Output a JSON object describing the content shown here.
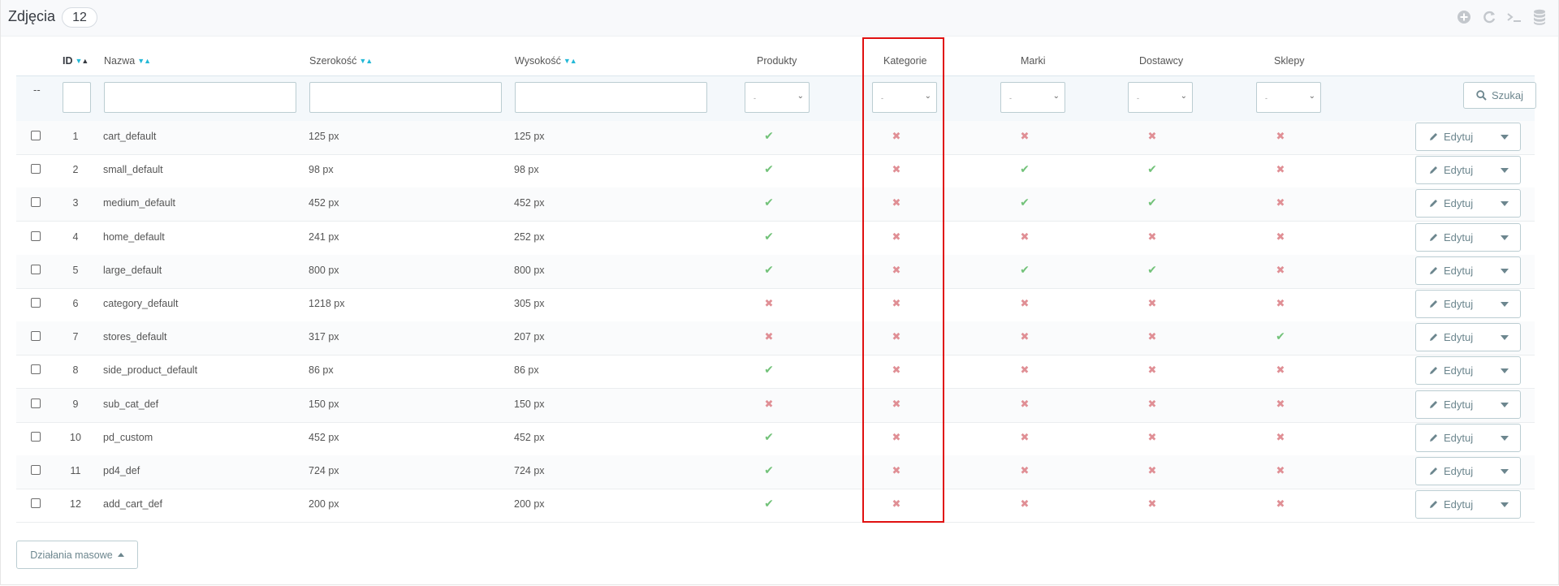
{
  "header": {
    "title": "Zdjęcia",
    "count": "12"
  },
  "toolbar": {
    "icons": [
      "plus-circle-icon",
      "refresh-icon",
      "terminal-icon",
      "database-icon"
    ]
  },
  "columns": {
    "id": "ID",
    "name": "Nazwa",
    "width": "Szerokość",
    "height": "Wysokość",
    "products": "Produkty",
    "categories": "Kategorie",
    "brands": "Marki",
    "suppliers": "Dostawcy",
    "stores": "Sklepy"
  },
  "filters": {
    "dash": "--",
    "select_value": "-",
    "search_label": "Szukaj"
  },
  "rows": [
    {
      "id": "1",
      "name": "cart_default",
      "width": "125 px",
      "height": "125 px",
      "products": true,
      "categories": false,
      "brands": false,
      "suppliers": false,
      "stores": false
    },
    {
      "id": "2",
      "name": "small_default",
      "width": "98 px",
      "height": "98 px",
      "products": true,
      "categories": false,
      "brands": true,
      "suppliers": true,
      "stores": false
    },
    {
      "id": "3",
      "name": "medium_default",
      "width": "452 px",
      "height": "452 px",
      "products": true,
      "categories": false,
      "brands": true,
      "suppliers": true,
      "stores": false
    },
    {
      "id": "4",
      "name": "home_default",
      "width": "241 px",
      "height": "252 px",
      "products": true,
      "categories": false,
      "brands": false,
      "suppliers": false,
      "stores": false
    },
    {
      "id": "5",
      "name": "large_default",
      "width": "800 px",
      "height": "800 px",
      "products": true,
      "categories": false,
      "brands": true,
      "suppliers": true,
      "stores": false
    },
    {
      "id": "6",
      "name": "category_default",
      "width": "1218 px",
      "height": "305 px",
      "products": false,
      "categories": false,
      "brands": false,
      "suppliers": false,
      "stores": false
    },
    {
      "id": "7",
      "name": "stores_default",
      "width": "317 px",
      "height": "207 px",
      "products": false,
      "categories": false,
      "brands": false,
      "suppliers": false,
      "stores": true
    },
    {
      "id": "8",
      "name": "side_product_default",
      "width": "86 px",
      "height": "86 px",
      "products": true,
      "categories": false,
      "brands": false,
      "suppliers": false,
      "stores": false
    },
    {
      "id": "9",
      "name": "sub_cat_def",
      "width": "150 px",
      "height": "150 px",
      "products": false,
      "categories": false,
      "brands": false,
      "suppliers": false,
      "stores": false
    },
    {
      "id": "10",
      "name": "pd_custom",
      "width": "452 px",
      "height": "452 px",
      "products": true,
      "categories": false,
      "brands": false,
      "suppliers": false,
      "stores": false
    },
    {
      "id": "11",
      "name": "pd4_def",
      "width": "724 px",
      "height": "724 px",
      "products": true,
      "categories": false,
      "brands": false,
      "suppliers": false,
      "stores": false
    },
    {
      "id": "12",
      "name": "add_cart_def",
      "width": "200 px",
      "height": "200 px",
      "products": true,
      "categories": false,
      "brands": false,
      "suppliers": false,
      "stores": false
    }
  ],
  "row_actions": {
    "edit_label": "Edytuj"
  },
  "bulk_actions": {
    "label": "Działania masowe"
  },
  "colors": {
    "check": "#72c279",
    "cross": "#e08f95",
    "accent": "#25b9d7",
    "highlight": "#e01010"
  }
}
